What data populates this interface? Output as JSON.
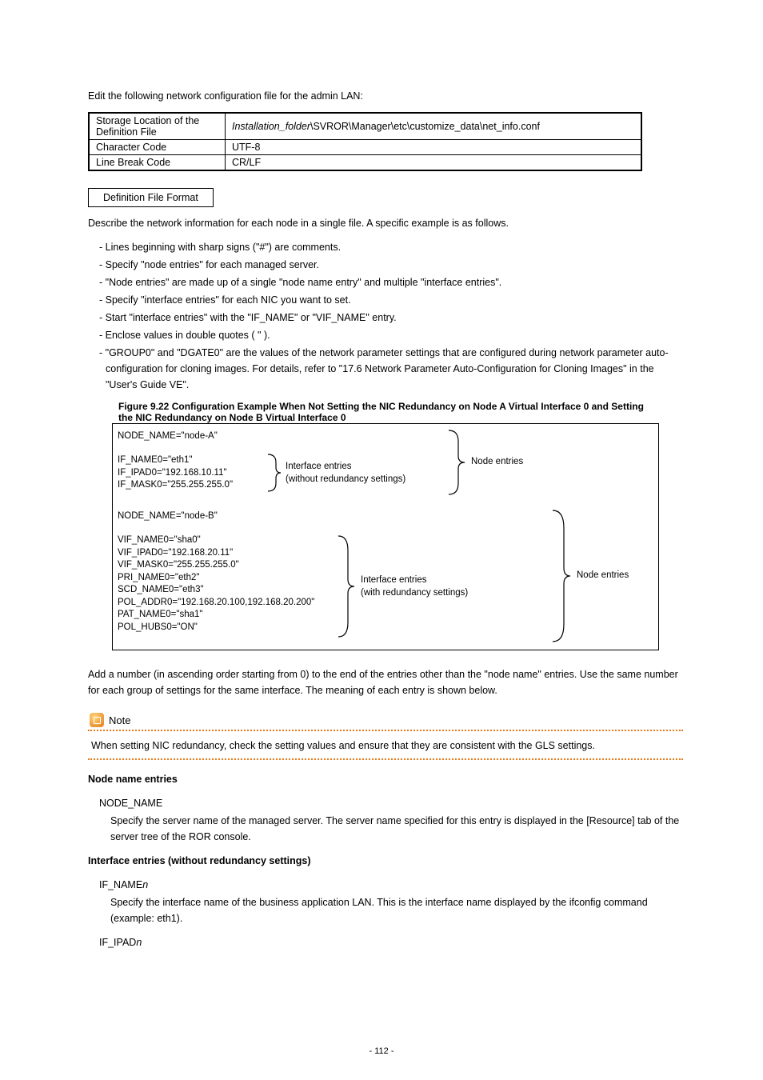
{
  "para_intro": "Edit the following network configuration file for the admin LAN:",
  "config_file": {
    "row1_label": "Storage Location of the\nDefinition File",
    "row1_value": "Installation_folder\\SVROR\\Manager\\etc\\customize_data\\net_info.conf",
    "row2_label": "Character Code",
    "row2_value": "UTF-8",
    "row3_label": "Line Break Code",
    "row3_value": "CR/LF"
  },
  "file_format_heading": "Definition File Format",
  "file_format_desc": "Describe the network information for each node in a single file. A specific example is as follows.",
  "file_format_items": [
    "- Lines beginning with sharp signs (\"#\") are comments.",
    "- Specify \"node entries\" for each managed server.",
    "- \"Node entries\" are made up of a single \"node name entry\" and multiple \"interface entries\".",
    "- Specify \"interface entries\" for each NIC you want to set.",
    "- Start \"interface entries\" with the \"IF_NAME\" or \"VIF_NAME\" entry.",
    "- Enclose values in double quotes ( \" ).",
    "- \"GROUP0\" and \"DGATE0\" are the values of the network parameter settings that are configured during network parameter auto-configuration for cloning images. For details, refer to \"17.6 Network Parameter Auto-Configuration for Cloning Images\" in the \"User's Guide VE\"."
  ],
  "figure": {
    "caption": "Figure 9.22 Configuration Example When Not Setting the NIC Redundancy on Node A Virtual Interface 0 and Setting the NIC Redundancy on Node B Virtual Interface 0",
    "nodeA_name": "NODE_NAME=\"node-A\"",
    "nodeA_if": [
      "IF_NAME0=\"eth1\"",
      "IF_IPAD0=\"192.168.10.11\"",
      "IF_MASK0=\"255.255.255.0\""
    ],
    "nodeB_name": "NODE_NAME=\"node-B\"",
    "nodeB_vif": [
      "VIF_NAME0=\"sha0\"",
      "VIF_IPAD0=\"192.168.20.11\"",
      "VIF_MASK0=\"255.255.255.0\"",
      "PRI_NAME0=\"eth2\"",
      "SCD_NAME0=\"eth3\"",
      "POL_ADDR0=\"192.168.20.100,192.168.20.200\"",
      "PAT_NAME0=\"sha1\"",
      "POL_HUBS0=\"ON\""
    ],
    "labels": {
      "interface_without": "Interface entries\n(without redundancy settings)",
      "interface_with": "Interface entries\n(with redundancy settings)",
      "node_entries": "Node entries"
    }
  },
  "after_figure_para": "Add a number (in ascending order starting from 0) to the end of the entries other than the \"node name\" entries. Use the same number for each group of settings for the same interface. The meaning of each entry is shown below.",
  "note": {
    "label": "Note",
    "body": "When setting NIC redundancy, check the setting values and ensure that they are consistent with the GLS settings."
  },
  "node_name_heading": "Node name entries",
  "node_name_entry_heading": "NODE_NAME",
  "node_name_entry_body": "Specify the server name of the managed server. The server name specified for this entry is displayed in the [Resource] tab of the server tree of the ROR console.",
  "interface_heading": "Interface entries (without redundancy settings)",
  "if_name_heading": "IF_NAME<n>",
  "if_name_body": "Specify the interface name of the business application LAN. This is the interface name displayed by the ifconfig command (example: eth1).",
  "if_ipad_heading": "IF_IPAD<n>",
  "page_number": "- 112 -"
}
